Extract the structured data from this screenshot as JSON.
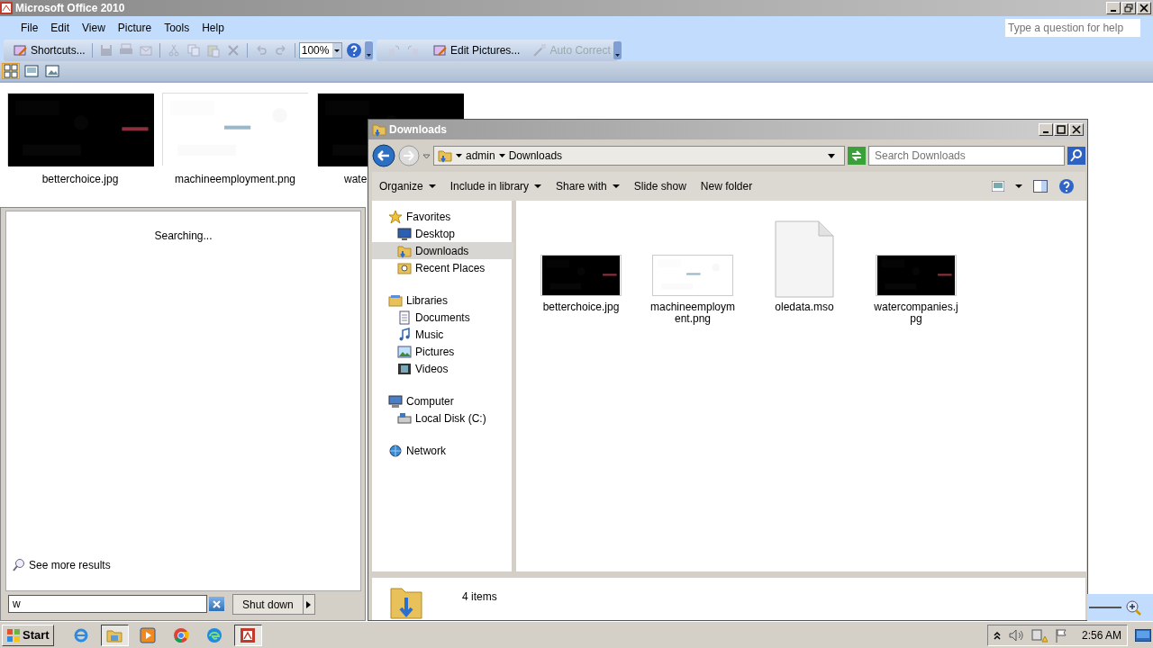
{
  "office": {
    "title": "Microsoft Office 2010",
    "menus": [
      "File",
      "Edit",
      "View",
      "Picture",
      "Tools",
      "Help"
    ],
    "help_placeholder": "Type a question for help",
    "toolbar": [
      {
        "kind": "text",
        "label": "Shortcuts...",
        "disabled": false
      },
      {
        "kind": "sep"
      },
      {
        "kind": "icon",
        "disabled": true
      },
      {
        "kind": "icon",
        "disabled": true
      },
      {
        "kind": "icon",
        "disabled": true
      },
      {
        "kind": "sep"
      },
      {
        "kind": "icon",
        "disabled": true
      },
      {
        "kind": "icon",
        "disabled": true
      },
      {
        "kind": "icon",
        "disabled": true
      },
      {
        "kind": "icon",
        "disabled": true
      },
      {
        "kind": "sep"
      },
      {
        "kind": "icon",
        "disabled": true
      },
      {
        "kind": "icon",
        "disabled": true
      },
      {
        "kind": "sep"
      },
      {
        "kind": "zoom",
        "label": "100%"
      },
      {
        "kind": "help"
      },
      {
        "kind": "end"
      },
      {
        "kind": "icon",
        "disabled": true
      },
      {
        "kind": "icon",
        "disabled": true
      },
      {
        "kind": "sep"
      },
      {
        "kind": "text",
        "label": "Edit Pictures...",
        "disabled": false
      },
      {
        "kind": "sep"
      },
      {
        "kind": "text",
        "label": "Auto Correct",
        "disabled": true
      },
      {
        "kind": "end"
      }
    ],
    "views": [
      {
        "selected": true
      },
      {
        "selected": false
      },
      {
        "selected": false
      }
    ],
    "thumbnails": [
      {
        "label": "betterchoice.jpg",
        "kind": "dark"
      },
      {
        "label": "machineemployment.png",
        "kind": "light"
      },
      {
        "label": "wate",
        "kind": "dark"
      }
    ]
  },
  "start_menu": {
    "status": "Searching...",
    "more": "See more results",
    "search_value": "w",
    "shutdown": "Shut down"
  },
  "explorer": {
    "title": "Downloads",
    "breadcrumb": [
      "admin",
      "Downloads"
    ],
    "search_placeholder": "Search Downloads",
    "commands": [
      {
        "label": "Organize",
        "dropdown": true
      },
      {
        "label": "Include in library",
        "dropdown": true
      },
      {
        "label": "Share with",
        "dropdown": true
      },
      {
        "label": "Slide show",
        "dropdown": false
      },
      {
        "label": "New folder",
        "dropdown": false
      }
    ],
    "nav": [
      {
        "label": "Favorites",
        "kind": "star",
        "selected": false,
        "children": [
          {
            "label": "Desktop",
            "kind": "desktop",
            "selected": false
          },
          {
            "label": "Downloads",
            "kind": "downloads",
            "selected": true
          },
          {
            "label": "Recent Places",
            "kind": "recent",
            "selected": false
          }
        ]
      },
      {
        "label": "Libraries",
        "kind": "library",
        "selected": false,
        "children": [
          {
            "label": "Documents",
            "kind": "documents",
            "selected": false
          },
          {
            "label": "Music",
            "kind": "music",
            "selected": false
          },
          {
            "label": "Pictures",
            "kind": "pictures",
            "selected": false
          },
          {
            "label": "Videos",
            "kind": "videos",
            "selected": false
          }
        ]
      },
      {
        "label": "Computer",
        "kind": "computer",
        "selected": false,
        "children": [
          {
            "label": "Local Disk (C:)",
            "kind": "disk",
            "selected": false
          }
        ]
      },
      {
        "label": "Network",
        "kind": "network",
        "selected": false
      }
    ],
    "files": [
      {
        "name": "betterchoice.jpg",
        "kind": "dark"
      },
      {
        "name": "machineemployment.png",
        "kind": "light"
      },
      {
        "name": "oledata.mso",
        "kind": "document"
      },
      {
        "name": "watercompanies.jpg",
        "kind": "dark"
      }
    ],
    "status": "4 items"
  },
  "taskbar": {
    "start": "Start",
    "apps": [
      {
        "kind": "ie",
        "selected": false
      },
      {
        "kind": "explorer",
        "selected": true
      },
      {
        "kind": "media",
        "selected": false
      },
      {
        "kind": "chrome",
        "selected": false
      },
      {
        "kind": "edge",
        "selected": false
      },
      {
        "kind": "office",
        "selected": true
      }
    ],
    "clock": "2:56 AM"
  }
}
